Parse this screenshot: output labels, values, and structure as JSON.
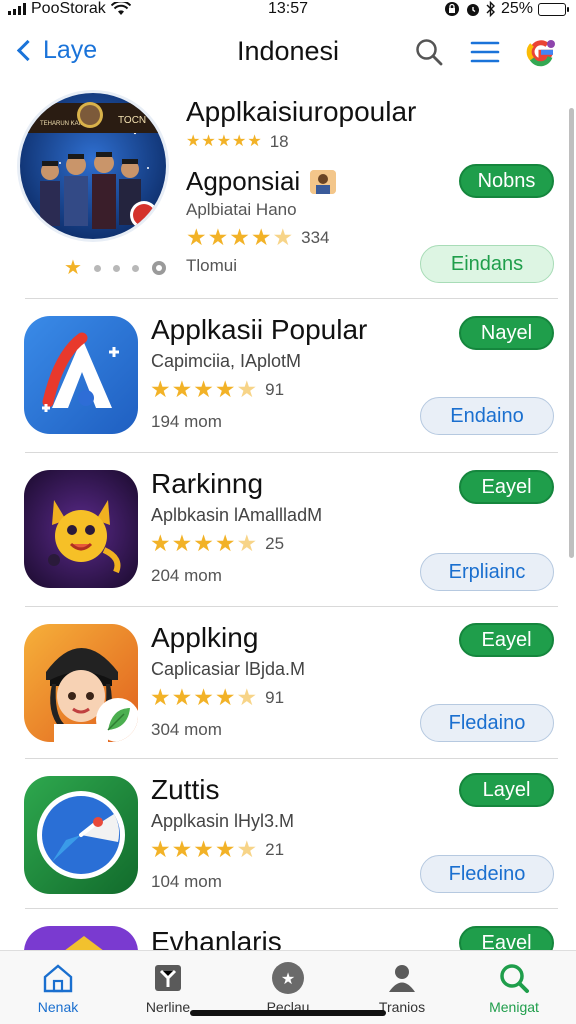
{
  "status_bar": {
    "carrier": "PooStorak",
    "time": "13:57",
    "battery": "25%",
    "battery_level": 0.25
  },
  "nav": {
    "back_label": "Laye",
    "title": "Indonesi"
  },
  "featured": {
    "title": "Applkaisiuropoular",
    "rating_count": "18",
    "sub_title": "Agponsiai",
    "description": "Aplbiatai Hano",
    "rating_count_2": "334",
    "meta": "Tlomui",
    "primary_button": "Nobns",
    "secondary_button": "Eindans",
    "badge": "TOCN",
    "rating": 5,
    "rating_2": 4.5
  },
  "apps": [
    {
      "title": "Applkasii Popular",
      "subtitle": "Capimciia, IAplotM",
      "rating": 4.5,
      "rating_count": "91",
      "meta": "194 mom",
      "primary_button": "Nayel",
      "secondary_button": "Endaino"
    },
    {
      "title": "Rarkinng",
      "subtitle": "Aplbkasin lAmallladM",
      "rating": 4.5,
      "rating_count": "25",
      "meta": "204 mom",
      "primary_button": "Eayel",
      "secondary_button": "Erpliainc"
    },
    {
      "title": "Applking",
      "subtitle": "Caplicasiar lBjda.M",
      "rating": 4.5,
      "rating_count": "91",
      "meta": "304 mom",
      "primary_button": "Eayel",
      "secondary_button": "Fledaino"
    },
    {
      "title": "Zuttis",
      "subtitle": "Applkasin lHyl3.M",
      "rating": 4.5,
      "rating_count": "21",
      "meta": "104 mom",
      "primary_button": "Layel",
      "secondary_button": "Fledeino"
    },
    {
      "title": "Evhanlaris",
      "primary_button": "Eavel"
    }
  ],
  "tabs": [
    {
      "label": "Nenak",
      "icon": "home-icon"
    },
    {
      "label": "Nerline",
      "icon": "flag-icon"
    },
    {
      "label": "Peclau",
      "icon": "star-circle-icon"
    },
    {
      "label": "Tranios",
      "icon": "person-icon"
    },
    {
      "label": "Menigat",
      "icon": "search-icon"
    }
  ],
  "colors": {
    "accent_blue": "#1a73d9",
    "get_green": "#1f9e4b",
    "star_gold": "#f2b227"
  }
}
